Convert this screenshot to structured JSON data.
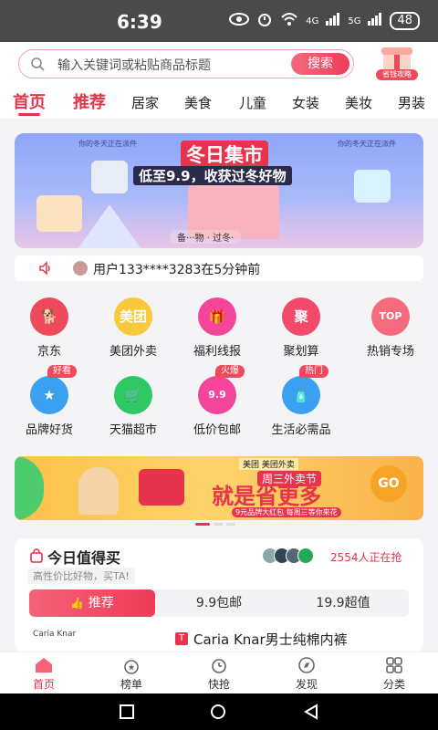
{
  "status_bar": {
    "time": "6:39",
    "network_4g": "4G",
    "network_5g": "5G",
    "battery": "48"
  },
  "search": {
    "placeholder": "输入关键词或粘贴商品标题",
    "button": "搜索",
    "badge_label": "省钱攻略"
  },
  "tabs": [
    "首页",
    "推荐",
    "居家",
    "美食",
    "儿童",
    "女装",
    "美妆",
    "男装"
  ],
  "hero": {
    "title": "冬日集市",
    "subtitle": "低至9.9，收获过冬好物",
    "ribbon_left": "你的冬天正在派件",
    "ribbon_right": "你的冬天正在派件",
    "footer": "备···物 · 过冬·"
  },
  "notice": {
    "text": "用户133****3283在5分钟前"
  },
  "grid": [
    {
      "label": "京东",
      "icon": "jd-dog-icon",
      "glyph": "🐕",
      "color": "#ee4a5c"
    },
    {
      "label": "美团外卖",
      "icon": "meituan-icon",
      "glyph": "美团",
      "color": "#f9c93a"
    },
    {
      "label": "福利线报",
      "icon": "gift-icon",
      "glyph": "🎁",
      "color": "#f3459a"
    },
    {
      "label": "聚划算",
      "icon": "juhuasuan-icon",
      "glyph": "聚",
      "color": "#f44a6a"
    },
    {
      "label": "热销专场",
      "icon": "top-icon",
      "glyph": "TOP",
      "color": "#f56a7c"
    },
    {
      "label": "品牌好货",
      "icon": "star-icon",
      "glyph": "★",
      "color": "#3aa0f2",
      "badge": "好看"
    },
    {
      "label": "天猫超市",
      "icon": "tmall-cart-icon",
      "glyph": "🛒",
      "color": "#2ec864"
    },
    {
      "label": "低价包邮",
      "icon": "price-99-icon",
      "glyph": "9.9",
      "color": "#f3459a",
      "badge": "火爆"
    },
    {
      "label": "生活必需品",
      "icon": "bottle-icon",
      "glyph": "🧴",
      "color": "#3aa0f2",
      "badge": "热门"
    }
  ],
  "promo": {
    "brand": "美团  美团外卖",
    "tag": "周三外卖节",
    "headline": "就是省更多",
    "fine_print": "9元品牌大红包 每周三等你来花",
    "go": "GO"
  },
  "daily": {
    "title": "今日值得买",
    "subtitle": "高性价比好物，买TA!",
    "count": "2554人正在抢",
    "tabs": [
      "推荐",
      "9.9包邮",
      "19.9超值"
    ],
    "thumb_brand": "Caria Knar",
    "product_tag": "T",
    "product_title": "Caria Knar男士纯棉内裤"
  },
  "bottom_nav": [
    "首页",
    "榜单",
    "快抢",
    "发现",
    "分类"
  ]
}
